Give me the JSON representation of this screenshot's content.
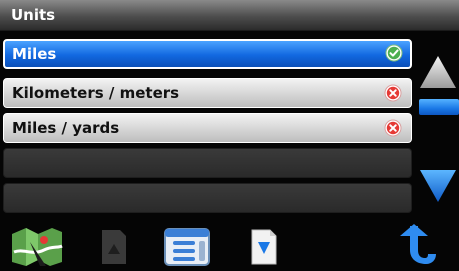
{
  "header": {
    "title": "Units"
  },
  "units": {
    "options": [
      {
        "label": "Miles",
        "state": "selected",
        "status_icon": "check-circle-icon"
      },
      {
        "label": "Kilometers / meters",
        "state": "unselected",
        "status_icon": "x-circle-icon"
      },
      {
        "label": "Miles / yards",
        "state": "unselected",
        "status_icon": "x-circle-icon"
      }
    ],
    "empty_rows": 2
  },
  "scrollbar": {
    "up_icon": "arrow-up-icon",
    "down_icon": "arrow-down-icon"
  },
  "toolbar": {
    "icons": [
      "map-icon",
      "page-up-icon",
      "menu-list-icon",
      "page-down-icon",
      "back-icon"
    ]
  },
  "colors": {
    "selected": "#1a6fe8",
    "check": "#4caf50",
    "cross": "#e53935",
    "scroll_accent": "#1a78e6",
    "background": "#050505"
  }
}
